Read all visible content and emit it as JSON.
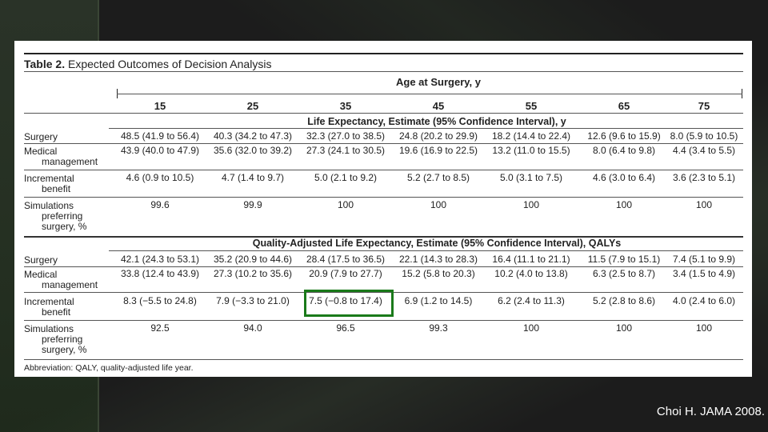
{
  "table": {
    "title_bold": "Table 2.",
    "title_rest": " Expected Outcomes of Decision Analysis",
    "age_header": "Age at Surgery, y",
    "ages": [
      "15",
      "25",
      "35",
      "45",
      "55",
      "65",
      "75"
    ],
    "le_header": "Life Expectancy, Estimate (95% Confidence Interval), y",
    "qaly_header": "Quality-Adjusted Life Expectancy, Estimate (95% Confidence Interval), QALYs",
    "le_rows": [
      {
        "label": [
          "Surgery"
        ],
        "values": [
          "48.5 (41.9 to 56.4)",
          "40.3 (34.2 to 47.3)",
          "32.3 (27.0 to 38.5)",
          "24.8 (20.2 to 29.9)",
          "18.2 (14.4 to 22.4)",
          "12.6 (9.6 to 15.9)",
          "8.0 (5.9 to 10.5)"
        ]
      },
      {
        "label": [
          "Medical",
          "management"
        ],
        "values": [
          "43.9 (40.0 to 47.9)",
          "35.6 (32.0 to 39.2)",
          "27.3 (24.1 to 30.5)",
          "19.6 (16.9 to 22.5)",
          "13.2 (11.0 to 15.5)",
          "8.0 (6.4 to 9.8)",
          "4.4 (3.4 to 5.5)"
        ]
      },
      {
        "label": [
          "Incremental",
          "benefit"
        ],
        "values": [
          "4.6 (0.9 to 10.5)",
          "4.7 (1.4 to 9.7)",
          "5.0 (2.1 to 9.2)",
          "5.2 (2.7 to 8.5)",
          "5.0 (3.1 to 7.5)",
          "4.6 (3.0 to 6.4)",
          "3.6 (2.3 to 5.1)"
        ]
      },
      {
        "label": [
          "Simulations",
          "preferring",
          "surgery, %"
        ],
        "values": [
          "99.6",
          "99.9",
          "100",
          "100",
          "100",
          "100",
          "100"
        ]
      }
    ],
    "qaly_rows": [
      {
        "label": [
          "Surgery"
        ],
        "values": [
          "42.1 (24.3 to 53.1)",
          "35.2 (20.9 to 44.6)",
          "28.4 (17.5 to 36.5)",
          "22.1 (14.3 to 28.3)",
          "16.4 (11.1 to 21.1)",
          "11.5 (7.9 to 15.1)",
          "7.4 (5.1 to 9.9)"
        ]
      },
      {
        "label": [
          "Medical",
          "management"
        ],
        "values": [
          "33.8 (12.4 to 43.9)",
          "27.3 (10.2 to 35.6)",
          "20.9 (7.9 to 27.7)",
          "15.2 (5.8 to 20.3)",
          "10.2 (4.0 to 13.8)",
          "6.3 (2.5 to 8.7)",
          "3.4 (1.5 to 4.9)"
        ]
      },
      {
        "label": [
          "Incremental",
          "benefit"
        ],
        "values": [
          "8.3 (−5.5 to 24.8)",
          "7.9 (−3.3 to 21.0)",
          "7.5 (−0.8 to 17.4)",
          "6.9 (1.2 to 14.5)",
          "6.2 (2.4 to 11.3)",
          "5.2 (2.8 to 8.6)",
          "4.0 (2.4 to 6.0)"
        ]
      },
      {
        "label": [
          "Simulations",
          "preferring",
          "surgery, %"
        ],
        "values": [
          "92.5",
          "94.0",
          "96.5",
          "99.3",
          "100",
          "100",
          "100"
        ]
      }
    ],
    "abbreviation": "Abbreviation: QALY, quality-adjusted life year.",
    "highlight_color": "#1a7a1a"
  },
  "citation": "Choi H. JAMA 2008."
}
